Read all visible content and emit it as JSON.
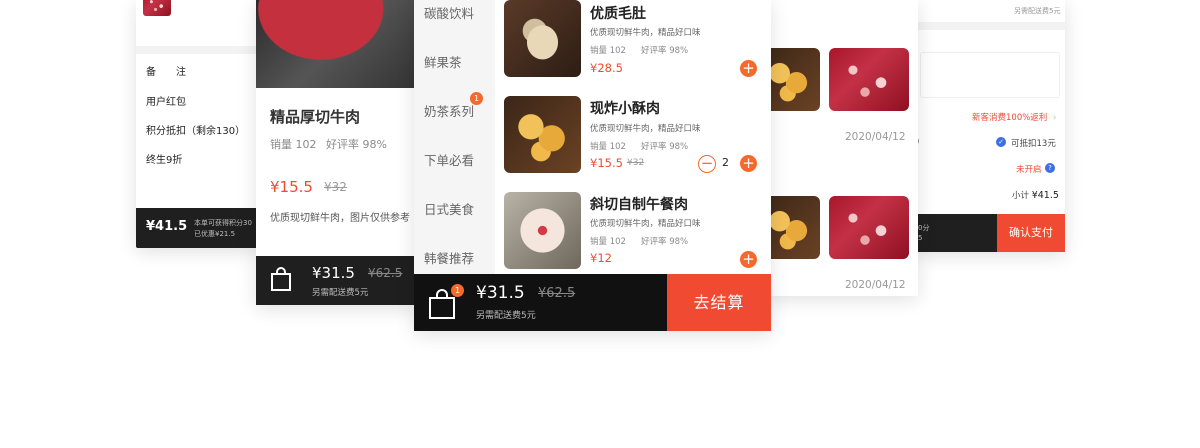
{
  "card1": {
    "rows": [
      {
        "label": "备　　注"
      },
      {
        "label": "用户红包"
      },
      {
        "label": "积分抵扣（剩余130）"
      },
      {
        "label": "终生9折"
      }
    ],
    "footer": {
      "price": "¥41.5",
      "line1": "本单可获得积分30",
      "line2": "已优惠¥21.5"
    }
  },
  "card2": {
    "title": "精品厚切牛肉",
    "sales": "销量 102",
    "rating": "好评率 98%",
    "price": "¥15.5",
    "old_price": "¥32",
    "desc": "优质现切鲜牛肉，图片仅供参考",
    "footer": {
      "price": "¥31.5",
      "old_price": "¥62.5",
      "delivery": "另需配送费5元"
    }
  },
  "card3": {
    "categories": [
      {
        "label": "碳酸饮料"
      },
      {
        "label": "鲜果茶"
      },
      {
        "label": "奶茶系列",
        "badge": "1"
      },
      {
        "label": "下单必看"
      },
      {
        "label": "日式美食"
      },
      {
        "label": "韩餐推荐"
      }
    ],
    "items": [
      {
        "name": "优质毛肚",
        "desc": "优质现切鲜牛肉，精品好口味",
        "sales": "销量 102",
        "rating": "好评率 98%",
        "price": "¥28.5",
        "old_price": ""
      },
      {
        "name": "现炸小酥肉",
        "desc": "优质现切鲜牛肉，精品好口味",
        "sales": "销量 102",
        "rating": "好评率 98%",
        "price": "¥15.5",
        "old_price": "¥32",
        "qty": "2"
      },
      {
        "name": "斜切自制午餐肉",
        "desc": "优质现切鲜牛肉，精品好口味",
        "sales": "销量 102",
        "rating": "好评率 98%",
        "price": "¥12",
        "old_price": ""
      }
    ],
    "footer": {
      "cart_badge": "1",
      "price": "¥31.5",
      "old_price": "¥62.5",
      "delivery": "另需配送费5元",
      "checkout": "去结算"
    }
  },
  "card4": {
    "date1": "2020/04/12",
    "date2": "2020/04/12"
  },
  "card5": {
    "top_note": "另需配送费5元",
    "promo": "新客消费100%返利",
    "deduct_left": ")",
    "deduct": "可抵扣13元",
    "not_enabled": "未开启",
    "subtotal_label": "小计",
    "subtotal": "¥41.5",
    "footer": {
      "line1": "0分",
      "line2": "5",
      "confirm": "确认支付"
    }
  },
  "colors": {
    "accent": "#f04b32",
    "dark": "#1f1f1f",
    "orange": "#f46a2c"
  }
}
